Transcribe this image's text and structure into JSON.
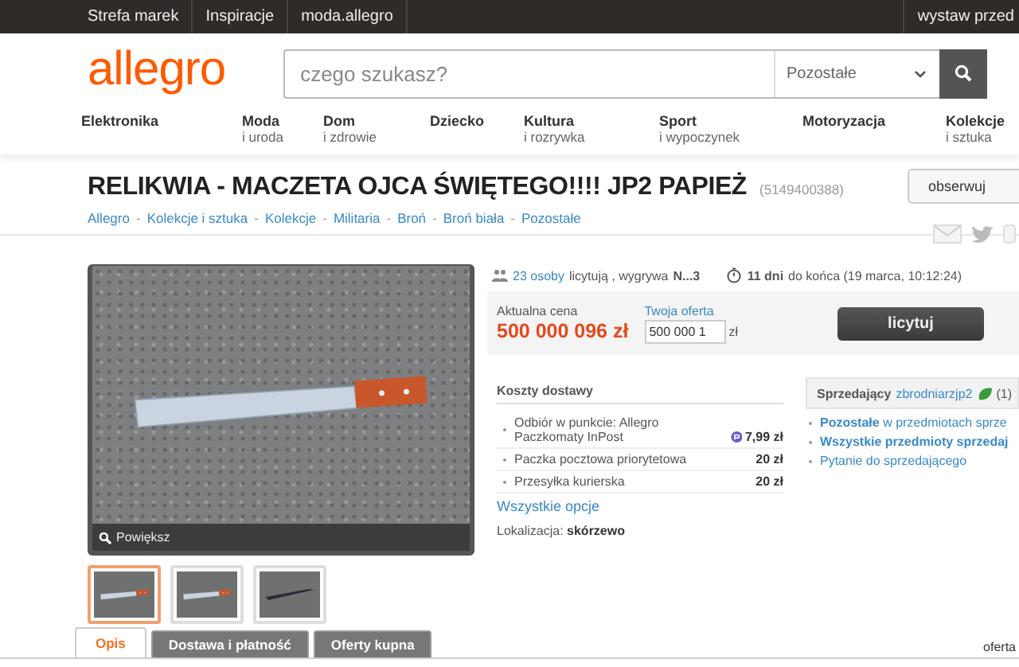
{
  "top_bar": {
    "links": [
      "Strefa marek",
      "Inspiracje",
      "moda.allegro"
    ],
    "right_link": "wystaw przed"
  },
  "header": {
    "logo": "allegro",
    "search": {
      "placeholder": "czego szukasz?",
      "category": "Pozostałe"
    }
  },
  "categories": [
    {
      "name": "Elektronika"
    },
    {
      "name": "Moda",
      "sub": "i uroda"
    },
    {
      "name": "Dom",
      "sub": "i zdrowie"
    },
    {
      "name": "Dziecko"
    },
    {
      "name": "Kultura",
      "sub": "i rozrywka"
    },
    {
      "name": "Sport",
      "sub": "i wypoczynek"
    },
    {
      "name": "Motoryzacja"
    },
    {
      "name": "Kolekcje",
      "sub": "i sztuka"
    }
  ],
  "offer": {
    "title": "RELIKWIA - MACZETA OJCA ŚWIĘTEGO!!!! JP2 PAPIEŻ",
    "number": "(5149400388)",
    "watch_button": "obserwuj",
    "breadcrumb_separator": "-",
    "breadcrumb": [
      "Allegro",
      "Kolekcje i sztuka",
      "Kolekcje",
      "Militaria",
      "Broń",
      "Broń biała",
      "Pozostałe"
    ]
  },
  "gallery": {
    "zoom_label": "Powiększ",
    "thumbnails": [
      {
        "kind": "knife",
        "selected": true
      },
      {
        "kind": "knife",
        "selected": false
      },
      {
        "kind": "blade",
        "selected": false
      }
    ]
  },
  "bidding": {
    "bidders_link": "23 osoby",
    "bidders_text": "licytują , wygrywa",
    "leader": "N...3",
    "time_left": "11 dni",
    "time_text": "do końca (19 marca, 10:12:24)",
    "price_label": "Aktualna cena",
    "price": "500 000 096 zł",
    "offer_label": "Twoja oferta",
    "offer_value": "500 000 1",
    "currency": "zł",
    "bid_button": "licytuj"
  },
  "delivery": {
    "title": "Koszty dostawy",
    "options": [
      {
        "kind": "locker",
        "name": "Odbiór w punkcie: Allegro Paczkomaty InPost",
        "price": "7,99 zł"
      },
      {
        "kind": "plain",
        "name": "Paczka pocztowa priorytetowa",
        "price": "20 zł"
      },
      {
        "kind": "plain",
        "name": "Przesyłka kurierska",
        "price": "20 zł"
      }
    ],
    "all_options_link": "Wszystkie opcje",
    "location_label": "Lokalizacja:",
    "location": "skórzewo"
  },
  "seller": {
    "label": "Sprzedający",
    "name": "zbrodniarzjp2",
    "rating": "(1)",
    "links": [
      {
        "text": "**Pozostałe** w przedmiotach sprze",
        "bold": false
      },
      {
        "text": "Wszystkie przedmioty sprzedaj",
        "bold": true
      },
      {
        "text": "Pytanie do sprzedającego",
        "bold": false
      }
    ]
  },
  "tabs": [
    {
      "label": "Opis",
      "selected": true
    },
    {
      "label": "Dostawa i płatność",
      "selected": false
    },
    {
      "label": "Oferty kupna",
      "selected": false
    }
  ],
  "tabs_right": "oferta"
}
